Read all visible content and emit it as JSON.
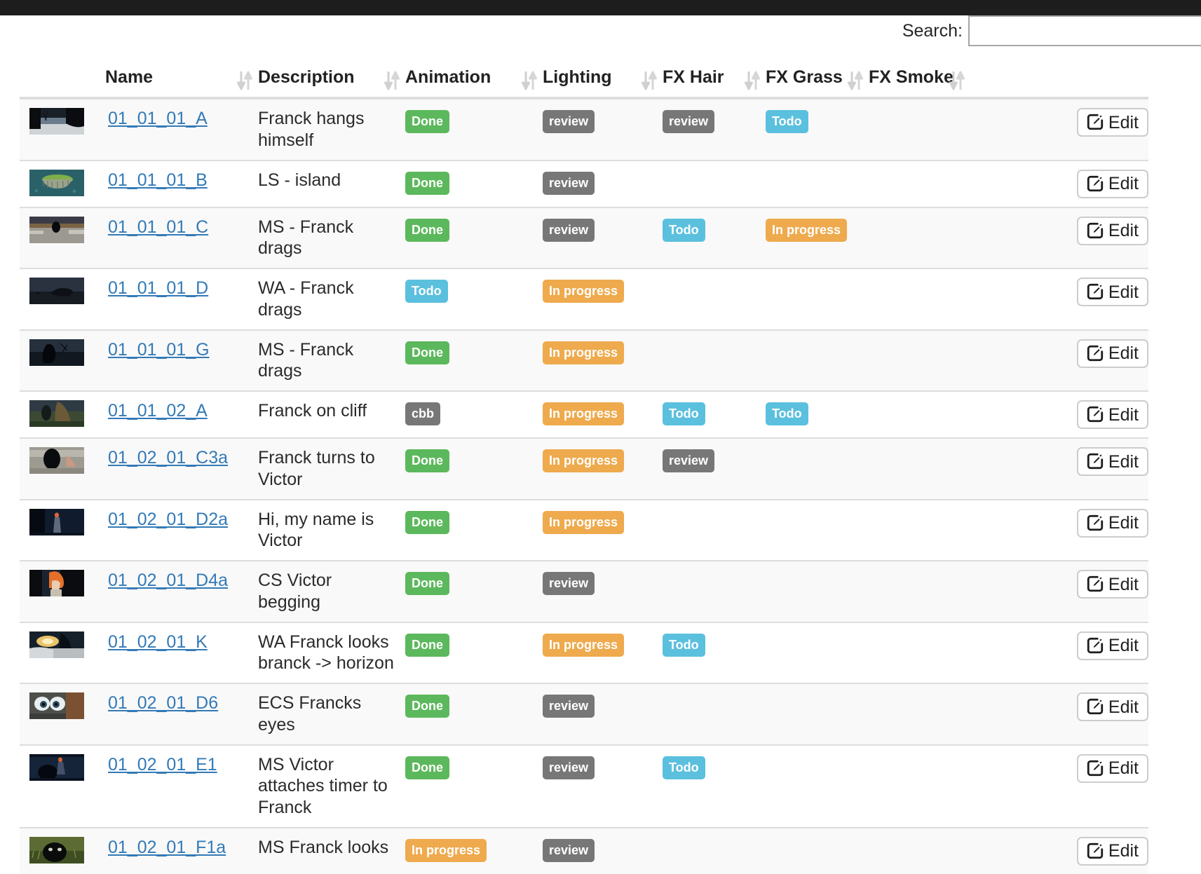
{
  "topbar": {
    "present": true,
    "color": "#1d1d1d"
  },
  "search": {
    "label": "Search:",
    "value": "",
    "placeholder": ""
  },
  "table": {
    "sort_icon_name": "sort-updown-icon",
    "columns": [
      {
        "key": "thumb",
        "label": "",
        "sortable": false
      },
      {
        "key": "name",
        "label": "Name",
        "sortable": true
      },
      {
        "key": "desc",
        "label": "Description",
        "sortable": true
      },
      {
        "key": "anim",
        "label": "Animation",
        "sortable": true
      },
      {
        "key": "light",
        "label": "Lighting",
        "sortable": true
      },
      {
        "key": "hair",
        "label": "FX Hair",
        "sortable": true
      },
      {
        "key": "grass",
        "label": "FX Grass",
        "sortable": true
      },
      {
        "key": "smoke",
        "label": "FX Smoke",
        "sortable": true
      },
      {
        "key": "edit",
        "label": "",
        "sortable": false
      }
    ],
    "edit_label": "Edit",
    "status_colors": {
      "Done": "#5cb85c",
      "Todo": "#5bc0de",
      "In progress": "#eeaa4d",
      "review": "#777777",
      "cbb": "#777777"
    },
    "rows": [
      {
        "name": "01_01_01_A",
        "description": "Franck hangs himself",
        "animation": "Done",
        "lighting": "review",
        "fx_hair": "review",
        "fx_grass": "Todo",
        "fx_smoke": "",
        "thumb": "dark-landscape-branches"
      },
      {
        "name": "01_01_01_B",
        "description": "LS - island",
        "animation": "Done",
        "lighting": "review",
        "fx_hair": "",
        "fx_grass": "",
        "fx_smoke": "",
        "thumb": "green-island-ocean"
      },
      {
        "name": "01_01_01_C",
        "description": "MS - Franck drags",
        "animation": "Done",
        "lighting": "review",
        "fx_hair": "Todo",
        "fx_grass": "In progress",
        "fx_smoke": "",
        "thumb": "sunset-beach-figure"
      },
      {
        "name": "01_01_01_D",
        "description": "WA - Franck drags",
        "animation": "Todo",
        "lighting": "In progress",
        "fx_hair": "",
        "fx_grass": "",
        "fx_smoke": "",
        "thumb": "night-rocks-plain"
      },
      {
        "name": "01_01_01_G",
        "description": "MS - Franck drags",
        "animation": "Done",
        "lighting": "In progress",
        "fx_hair": "",
        "fx_grass": "",
        "fx_smoke": "",
        "thumb": "night-figure-tree"
      },
      {
        "name": "01_01_02_A",
        "description": "Franck on cliff",
        "animation": "cbb",
        "lighting": "In progress",
        "fx_hair": "Todo",
        "fx_grass": "Todo",
        "fx_smoke": "",
        "thumb": "cliff-figure-grass"
      },
      {
        "name": "01_02_01_C3a",
        "description": "Franck turns to Victor",
        "animation": "Done",
        "lighting": "In progress",
        "fx_hair": "review",
        "fx_grass": "",
        "fx_smoke": "",
        "thumb": "pale-ground-figure"
      },
      {
        "name": "01_02_01_D2a",
        "description": "Hi, my name is Victor",
        "animation": "Done",
        "lighting": "In progress",
        "fx_hair": "",
        "fx_grass": "",
        "fx_smoke": "",
        "thumb": "dark-blue-standing-figure"
      },
      {
        "name": "01_02_01_D4a",
        "description": "CS Victor begging",
        "animation": "Done",
        "lighting": "review",
        "fx_hair": "",
        "fx_grass": "",
        "fx_smoke": "",
        "thumb": "closeup-orange-hair"
      },
      {
        "name": "01_02_01_K",
        "description": "WA Franck looks branck -> horizon",
        "animation": "Done",
        "lighting": "In progress",
        "fx_hair": "Todo",
        "fx_grass": "",
        "fx_smoke": "",
        "thumb": "lit-cave-horizon"
      },
      {
        "name": "01_02_01_D6",
        "description": "ECS Francks eyes",
        "animation": "Done",
        "lighting": "review",
        "fx_hair": "",
        "fx_grass": "",
        "fx_smoke": "",
        "thumb": "extreme-closeup-eyes"
      },
      {
        "name": "01_02_01_E1",
        "description": "MS Victor attaches timer to Franck",
        "animation": "Done",
        "lighting": "review",
        "fx_hair": "Todo",
        "fx_grass": "",
        "fx_smoke": "",
        "thumb": "night-two-figures"
      },
      {
        "name": "01_02_01_F1a",
        "description": "MS Franck looks",
        "animation": "In progress",
        "lighting": "review",
        "fx_hair": "",
        "fx_grass": "",
        "fx_smoke": "",
        "thumb": "grass-dark-head"
      }
    ]
  }
}
